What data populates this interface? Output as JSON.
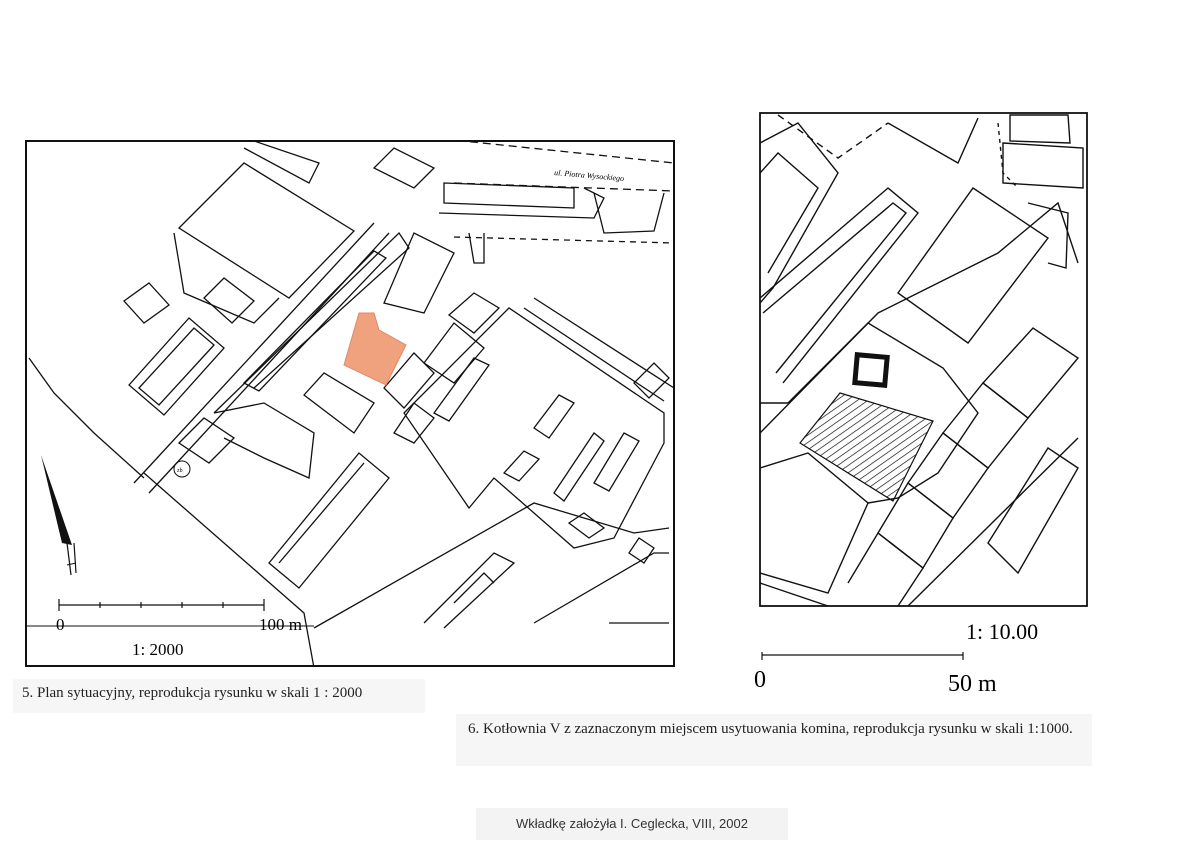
{
  "left_map": {
    "street_label": "ul. Piotra Wysockiego",
    "symbol_label": "zb",
    "scale_start": "0",
    "scale_end": "100 m",
    "scale_ratio": "1: 2000",
    "highlight_color": "#f0a27e",
    "caption": "5. Plan sytuacyjny, reprodukcja rysunku w skali 1 : 2000"
  },
  "right_map": {
    "scale_ratio": "1: 10.00",
    "scale_start": "0",
    "scale_end": "50 m",
    "caption": "6. Kotłownia V z zaznaczonym miejscem usytuowania komina, reprodukcja rysunku w skali 1:1000."
  },
  "footer": {
    "credit": "Wkładkę założyła I. Ceglecka, VIII, 2002"
  }
}
